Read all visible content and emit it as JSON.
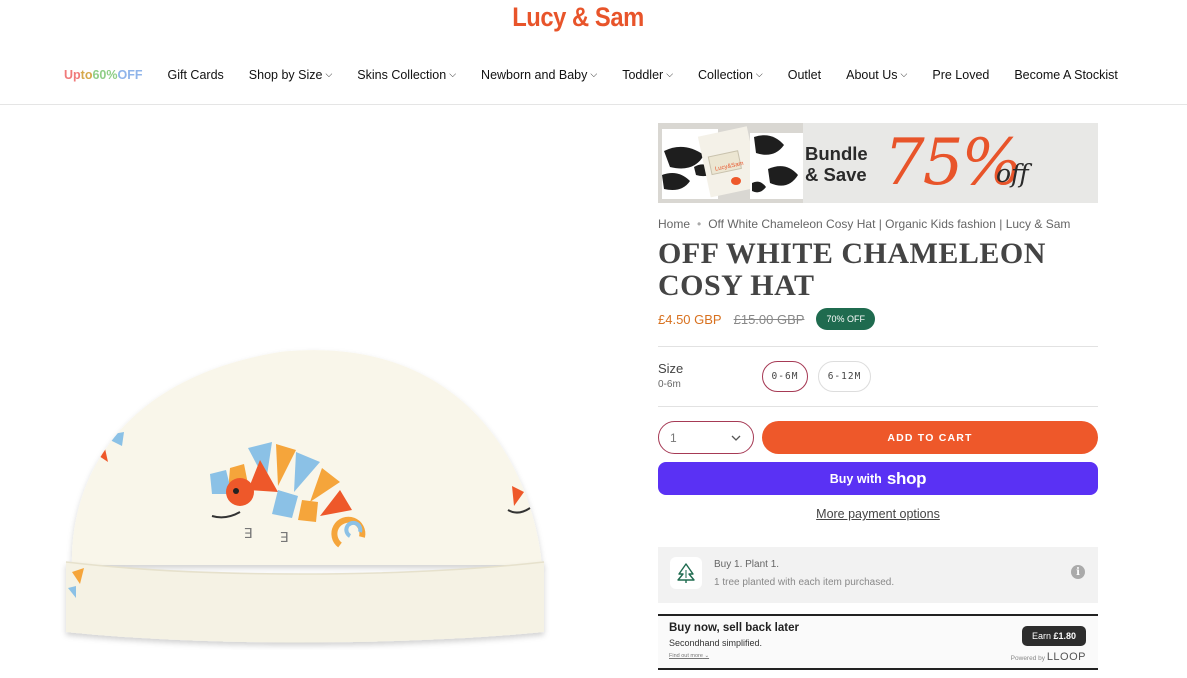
{
  "header": {
    "logo": "Lucy & Sam"
  },
  "nav": {
    "promo": {
      "parts": [
        "Up ",
        "to ",
        "60% ",
        "OFF"
      ],
      "colors": [
        "#f07a7a",
        "#d6a94a",
        "#8fce86",
        "#8fb4ea"
      ]
    },
    "items": [
      {
        "label": "Gift Cards",
        "dropdown": false
      },
      {
        "label": "Shop by Size",
        "dropdown": true
      },
      {
        "label": "Skins Collection",
        "dropdown": true
      },
      {
        "label": "Newborn and Baby",
        "dropdown": true
      },
      {
        "label": "Toddler",
        "dropdown": true
      },
      {
        "label": "Collection",
        "dropdown": true
      },
      {
        "label": "Outlet",
        "dropdown": false
      },
      {
        "label": "About Us",
        "dropdown": true
      },
      {
        "label": "Pre Loved",
        "dropdown": false
      },
      {
        "label": "Become A Stockist",
        "dropdown": false
      }
    ]
  },
  "banner": {
    "line1": "Bundle",
    "line2": "& Save",
    "percent": "75%",
    "off": "off"
  },
  "breadcrumb": {
    "home": "Home",
    "current": "Off White Chameleon Cosy Hat | Organic Kids fashion | Lucy & Sam"
  },
  "product": {
    "title_line1": "OFF WHITE CHAMELEON",
    "title_line2": "COSY HAT",
    "sale_price": "£4.50 GBP",
    "compare_price": "£15.00 GBP",
    "discount_badge": "70% OFF"
  },
  "size": {
    "label": "Size",
    "selected_value": "0-6m",
    "options": [
      "0-6M",
      "6-12M"
    ]
  },
  "purchase": {
    "quantity": "1",
    "add_to_cart": "ADD TO CART",
    "buy_with": "Buy with",
    "shop_word": "shop",
    "more_payment": "More payment options"
  },
  "plant": {
    "title": "Buy 1. Plant 1.",
    "subtitle": "1 tree planted with each item purchased."
  },
  "loop": {
    "title": "Buy now, sell back later",
    "subtitle": "Secondhand simplified.",
    "find_out": "Find out more",
    "earn_label": "Earn",
    "earn_amount": "£1.80",
    "powered_by": "Powered by",
    "brand": "LLOOP"
  },
  "colors": {
    "brand_orange": "#ee582a",
    "shop_purple": "#5a31f4",
    "badge_green": "#1f6b4f",
    "selected_border": "#a63a55"
  }
}
